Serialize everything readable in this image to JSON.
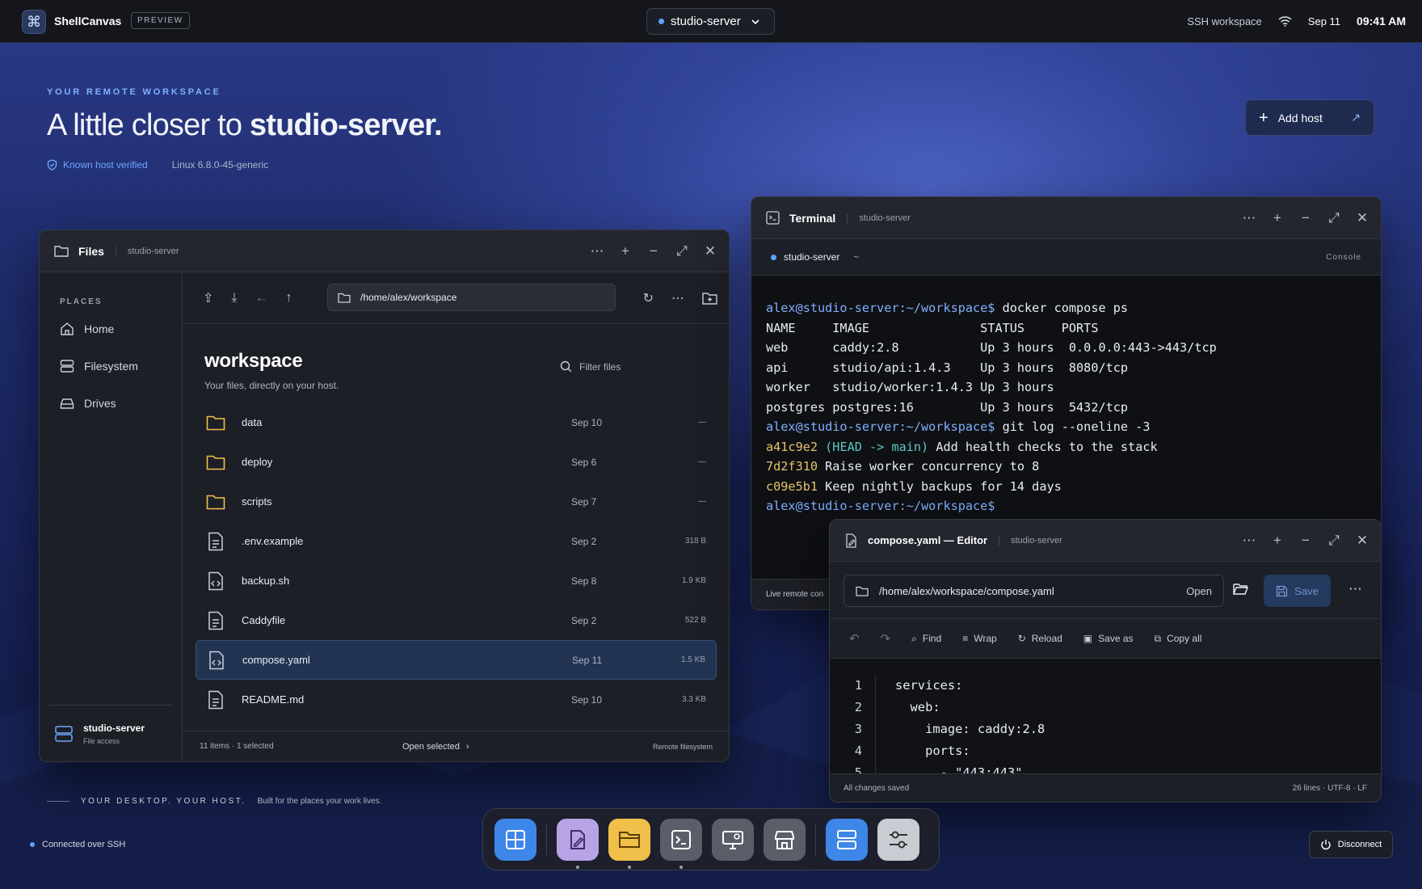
{
  "topbar": {
    "app_name": "ShellCanvas",
    "preview_badge": "PREVIEW",
    "host": "studio-server",
    "workspace_label": "SSH workspace",
    "date": "Sep 11",
    "time": "09:41 AM"
  },
  "hero": {
    "eyebrow": "YOUR REMOTE WORKSPACE",
    "title_prefix": "A little closer to ",
    "title_host": "studio-server.",
    "verified": "Known host verified",
    "kernel": "Linux 6.8.0-45-generic",
    "add_host": "Add host"
  },
  "files": {
    "title": "Files",
    "host": "studio-server",
    "places_heading": "PLACES",
    "places": [
      {
        "label": "Home",
        "icon": "home-icon"
      },
      {
        "label": "Filesystem",
        "icon": "server-icon"
      },
      {
        "label": "Drives",
        "icon": "drive-icon"
      }
    ],
    "footer_host": "studio-server",
    "footer_sub": "File access",
    "path": "/home/alex/workspace",
    "folder": "workspace",
    "folder_desc": "Your files, directly on your host.",
    "filter_placeholder": "Filter files",
    "rows": [
      {
        "name": "data",
        "date": "Sep 10",
        "size": "—",
        "kind": "folder"
      },
      {
        "name": "deploy",
        "date": "Sep 6",
        "size": "—",
        "kind": "folder"
      },
      {
        "name": "scripts",
        "date": "Sep 7",
        "size": "—",
        "kind": "folder"
      },
      {
        "name": ".env.example",
        "date": "Sep 2",
        "size": "318 B",
        "kind": "doc"
      },
      {
        "name": "backup.sh",
        "date": "Sep 8",
        "size": "1.9 KB",
        "kind": "code"
      },
      {
        "name": "Caddyfile",
        "date": "Sep 2",
        "size": "522 B",
        "kind": "doc"
      },
      {
        "name": "compose.yaml",
        "date": "Sep 11",
        "size": "1.5 KB",
        "kind": "code"
      },
      {
        "name": "README.md",
        "date": "Sep 10",
        "size": "3.3 KB",
        "kind": "doc"
      }
    ],
    "status": "11 items · 1 selected",
    "open_selected": "Open selected",
    "remote": "Remote filesystem"
  },
  "terminal": {
    "title": "Terminal",
    "host": "studio-server",
    "tab_host": "studio-server",
    "tab_path": "~",
    "console": "Console",
    "prompt": "alex@studio-server:~/workspace$",
    "cmd1": " docker compose ps",
    "ps_header": "NAME     IMAGE               STATUS     PORTS",
    "ps_rows": [
      "web      caddy:2.8           Up 3 hours  0.0.0.0:443->443/tcp",
      "api      studio/api:1.4.3    Up 3 hours  8080/tcp",
      "worker   studio/worker:1.4.3 Up 3 hours",
      "postgres postgres:16         Up 3 hours  5432/tcp"
    ],
    "cmd2": " git log --oneline -3",
    "log": [
      {
        "hash": "a41c9e2",
        "ref": " (HEAD -> main)",
        "msg": " Add health checks to the stack"
      },
      {
        "hash": "7d2f310",
        "ref": "",
        "msg": " Raise worker concurrency to 8"
      },
      {
        "hash": "c09e5b1",
        "ref": "",
        "msg": " Keep nightly backups for 14 days"
      }
    ],
    "footer": "Live remote con"
  },
  "editor": {
    "title": "compose.yaml — Editor",
    "host": "studio-server",
    "path": "/home/alex/workspace/compose.yaml",
    "open": "Open",
    "save": "Save",
    "tools": [
      "Find",
      "Wrap",
      "Reload",
      "Save as",
      "Copy all"
    ],
    "line_numbers": [
      "1",
      "2",
      "3",
      "4",
      "5"
    ],
    "lines": [
      "services:",
      "  web:",
      "    image: caddy:2.8",
      "    ports:",
      "      - \"443:443\""
    ],
    "status": "All changes saved",
    "info": "26 lines · UTF-8 · LF"
  },
  "footer": {
    "tagline": "YOUR DESKTOP. YOUR HOST.",
    "sub": "Built for the places your work lives.",
    "connection": "Connected over SSH",
    "disconnect": "Disconnect"
  },
  "dock": [
    {
      "name": "launcher-icon",
      "color": "#3e86e8"
    },
    {
      "name": "editor-icon",
      "color": "#b7a3e6"
    },
    {
      "name": "files-icon",
      "color": "#f0c04a"
    },
    {
      "name": "terminal-icon",
      "color": "#5a5e68"
    },
    {
      "name": "monitor-icon",
      "color": "#5a5e68"
    },
    {
      "name": "store-icon",
      "color": "#5a5e68"
    },
    {
      "name": "servers-icon",
      "color": "#3e86e8"
    },
    {
      "name": "settings-icon",
      "color": "#c9ccd3"
    }
  ],
  "colors": {
    "accent": "#5aa2ff",
    "prompt": "#7fb0ff",
    "hash": "#e7c46a",
    "selection": "#223452"
  }
}
